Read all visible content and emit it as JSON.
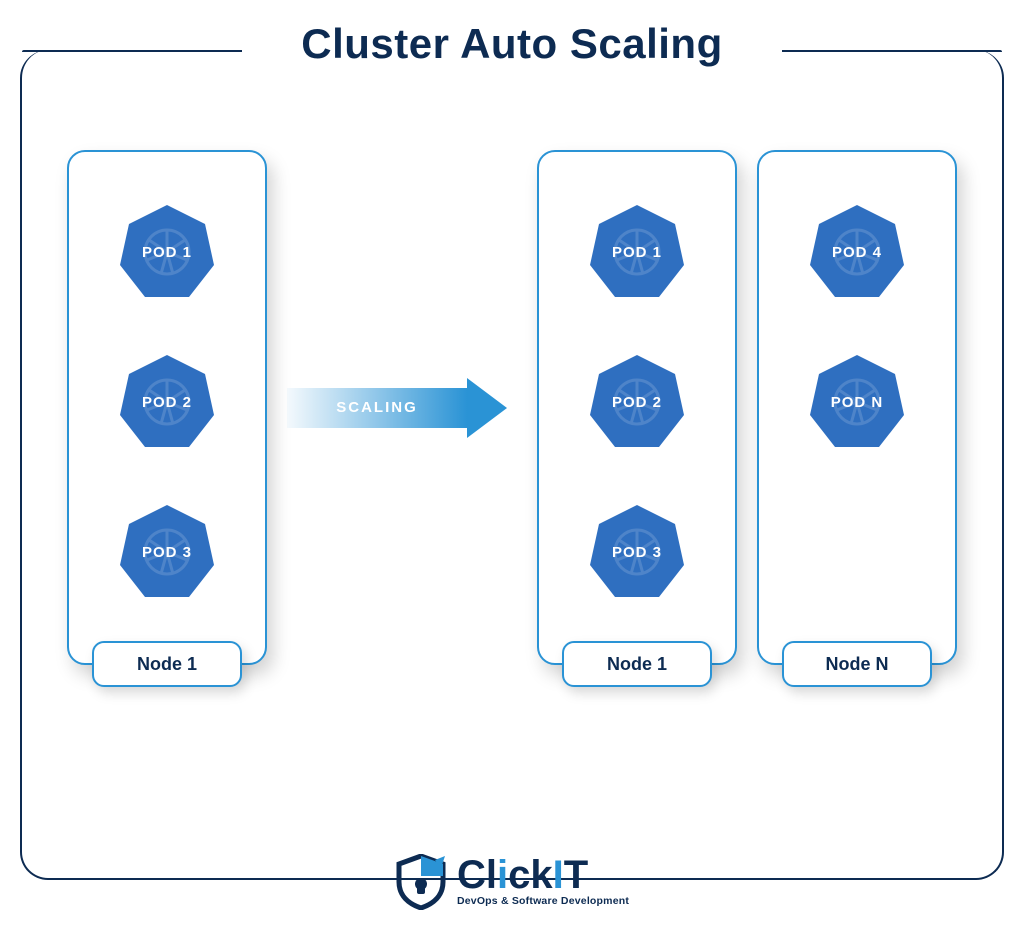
{
  "title": "Cluster Auto Scaling",
  "arrow_label": "SCALING",
  "left": {
    "node": {
      "label": "Node 1",
      "pods": [
        "POD 1",
        "POD 2",
        "POD 3"
      ]
    }
  },
  "right": {
    "nodes": [
      {
        "label": "Node 1",
        "pods": [
          "POD 1",
          "POD 2",
          "POD 3"
        ]
      },
      {
        "label": "Node N",
        "pods": [
          "POD 4",
          "POD N"
        ]
      }
    ]
  },
  "logo": {
    "brand": "ClickIT",
    "tagline": "DevOps & Software Development"
  }
}
